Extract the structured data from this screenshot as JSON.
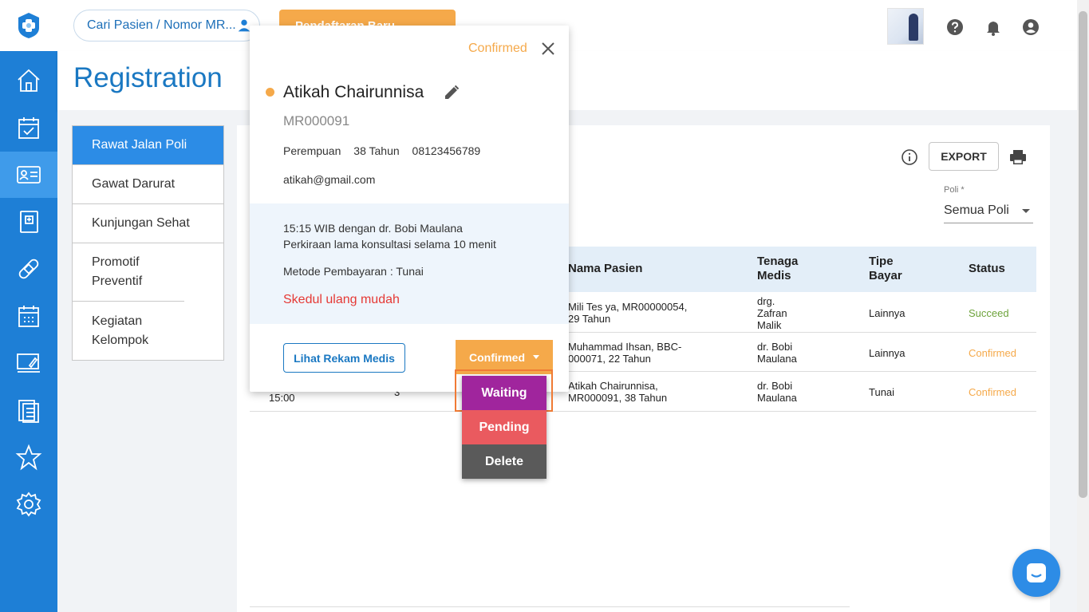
{
  "header": {
    "search_placeholder": "Cari Pasien / Nomor MR...",
    "new_registration_label": "Pendaftaran Baru"
  },
  "page": {
    "title": "Registration"
  },
  "subnav": [
    {
      "label": "Rawat Jalan Poli",
      "active": true
    },
    {
      "label": "Gawat Darurat",
      "active": false
    },
    {
      "label": "Kunjungan Sehat",
      "active": false
    },
    {
      "label": "Promotif Preventif",
      "active": false
    },
    {
      "label": "Kegiatan Kelompok",
      "active": false
    }
  ],
  "toolbar": {
    "export_label": "EXPORT"
  },
  "filter": {
    "poli_label": "Poli *",
    "poli_value": "Semua Poli"
  },
  "table": {
    "columns": [
      "Nama Pasien",
      "Tenaga Medis",
      "Tipe Bayar",
      "Status"
    ],
    "rows": [
      {
        "patient": "Mili Tes ya, MR00000054, 29 Tahun",
        "doctor": "drg. Zafran Malik",
        "payment": "Lainnya",
        "status": "Succeed"
      },
      {
        "patient": "Muhammad Ihsan, BBC-000071, 22 Tahun",
        "doctor": "dr. Bobi Maulana",
        "payment": "Lainnya",
        "status": "Confirmed"
      },
      {
        "time": "15:00",
        "queue": "3",
        "patient": "Atikah Chairunnisa, MR000091, 38 Tahun",
        "doctor": "dr. Bobi Maulana",
        "payment": "Tunai",
        "status": "Confirmed"
      }
    ]
  },
  "popup": {
    "status": "Confirmed",
    "name": "Atikah Chairunnisa",
    "mr": "MR000091",
    "gender": "Perempuan",
    "age": "38 Tahun",
    "phone": "08123456789",
    "email": "atikah@gmail.com",
    "schedule_line1": "15:15 WIB dengan dr. Bobi Maulana",
    "schedule_line2": "Perkiraan lama konsultasi selama 10 menit",
    "payment_method": "Metode Pembayaran : Tunai",
    "reschedule_label": "Skedul ulang mudah",
    "medical_record_button": "Lihat Rekam Medis",
    "status_button": "Confirmed"
  },
  "dropdown": {
    "options": [
      "Waiting",
      "Pending",
      "Delete"
    ]
  },
  "colors": {
    "primary": "#1e7fd6",
    "accent": "#f5a94a",
    "waiting": "#a0259d",
    "pending": "#ea5a5f",
    "delete": "#5a5a5a",
    "success": "#6da33b"
  }
}
